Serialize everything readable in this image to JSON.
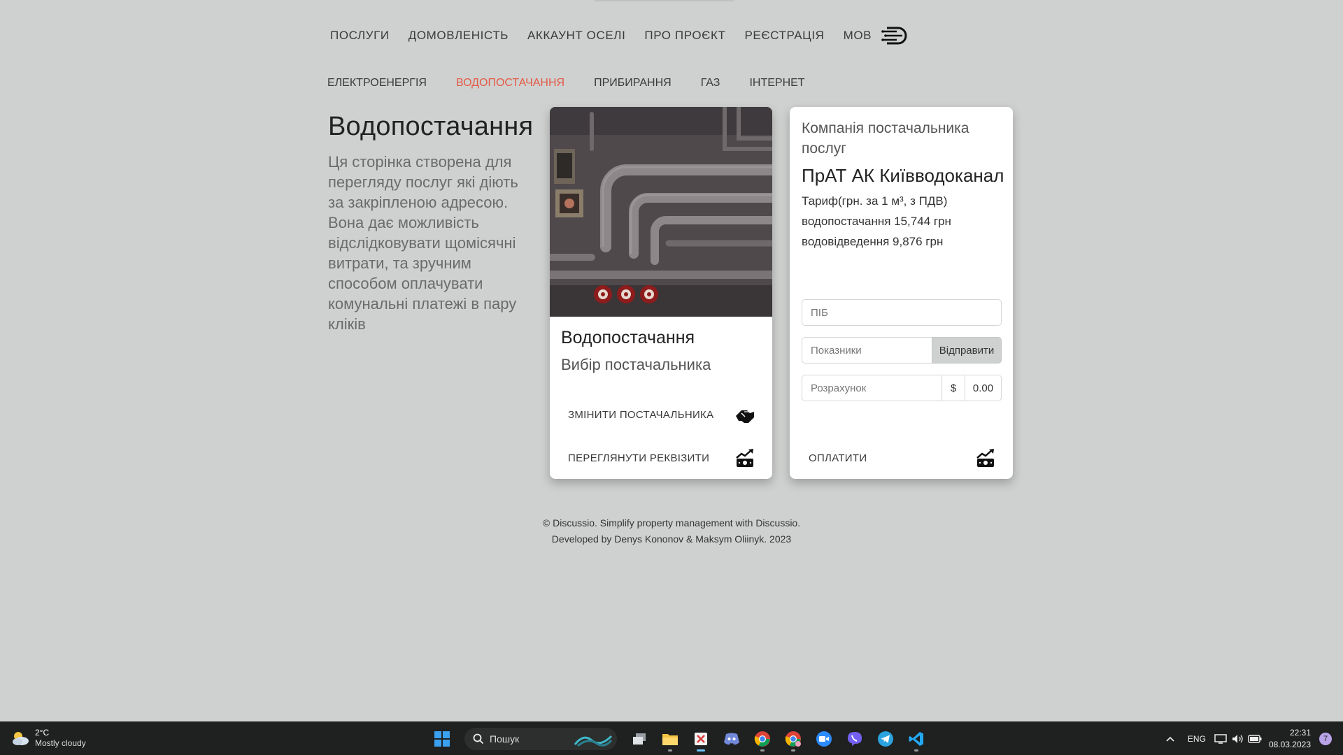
{
  "top_nav": {
    "items": [
      "ПОСЛУГИ",
      "ДОМОВЛЕНІСТЬ",
      "АККАУНТ ОСЕЛІ",
      "ПРО ПРОЄКТ",
      "РЕЄСТРАЦІЯ",
      "МОВ"
    ]
  },
  "sub_nav": {
    "items": [
      "ЕЛЕКТРОЕНЕРГІЯ",
      "ВОДОПОСТАЧАННЯ",
      "ПРИБИРАННЯ",
      "ГАЗ",
      "ІНТЕРНЕТ"
    ],
    "active": "ВОДОПОСТАЧАННЯ",
    "active_color": "#e35b47"
  },
  "intro": {
    "title": "Водопостачання",
    "description": "Ця сторінка створена для перегляду послуг які діють за закріпленою адресою. Вона дає можливість відслідковувати щомісячні витрати, та зручним способом оплачувати комунальні платежі в пару кліків"
  },
  "service_card": {
    "title": "Водопостачання",
    "subtitle": "Вибір постачальника",
    "change_label": "ЗМІНИТИ ПОСТАЧАЛЬНИКА",
    "details_label": "ПЕРЕГЛЯНУТИ РЕКВІЗИТИ"
  },
  "provider_card": {
    "heading": "Компанія постачальника послуг",
    "company": "ПрАТ АК Київводоканал",
    "tariff_title": "Тариф(грн. за 1 м³, з ПДВ)",
    "water_supply": "водопостачання 15,744 грн",
    "drainage": "водовідведення 9,876 грн",
    "name_placeholder": "ПІБ",
    "readings_placeholder": "Показники",
    "send_label": "Відправити",
    "calc_placeholder": "Розрахунок",
    "currency": "$",
    "amount": "0.00",
    "pay_label": "ОПЛАТИТИ"
  },
  "footer": {
    "line1": "© Discussio. Simplify property management with Discussio.",
    "line2": "Developed by Denys Kononov & Maksym Oliinyk. 2023"
  },
  "taskbar": {
    "weather_temp": "2°C",
    "weather_desc": "Mostly cloudy",
    "search_text": "Пошук",
    "lang": "ENG",
    "time": "22:31",
    "date": "08.03.2023",
    "notifications": "7",
    "apps": [
      "start-icon",
      "search",
      "task-view-icon",
      "file-explorer-icon",
      "snipping-tool-icon",
      "discord-icon",
      "chrome-icon",
      "chrome-profile-icon",
      "zoom-icon",
      "viber-icon",
      "telegram-icon",
      "vscode-icon"
    ]
  }
}
